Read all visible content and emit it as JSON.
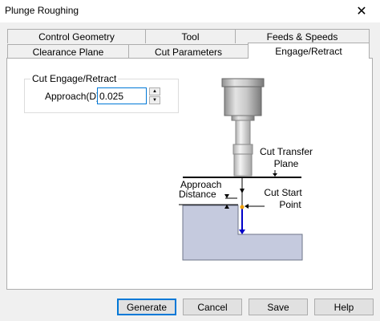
{
  "window": {
    "title": "Plunge Roughing",
    "close_glyph": "✕"
  },
  "tabs": {
    "row_back": [
      {
        "label": "Control Geometry"
      },
      {
        "label": "Tool"
      },
      {
        "label": "Feeds & Speeds"
      }
    ],
    "row_front": [
      {
        "label": "Clearance Plane"
      },
      {
        "label": "Cut Parameters"
      },
      {
        "label": "Engage/Retract",
        "active": true
      }
    ]
  },
  "group": {
    "title": "Cut Engage/Retract",
    "approach_label": "Approach(D)",
    "approach_value": "0.025",
    "spin_up": "▲",
    "spin_down": "▼"
  },
  "diagram": {
    "cut_transfer_line1": "Cut Transfer",
    "cut_transfer_line2": "Plane",
    "approach_line1": "Approach",
    "approach_line2": "Distance",
    "cut_start_line1": "Cut Start",
    "cut_start_line2": "Point"
  },
  "buttons": {
    "generate": "Generate",
    "cancel": "Cancel",
    "save": "Save",
    "help": "Help"
  },
  "colors": {
    "focus_border": "#0078d7",
    "workpiece_fill": "#c5cade",
    "path_line": "#0000c8",
    "start_point": "#f0a000"
  }
}
